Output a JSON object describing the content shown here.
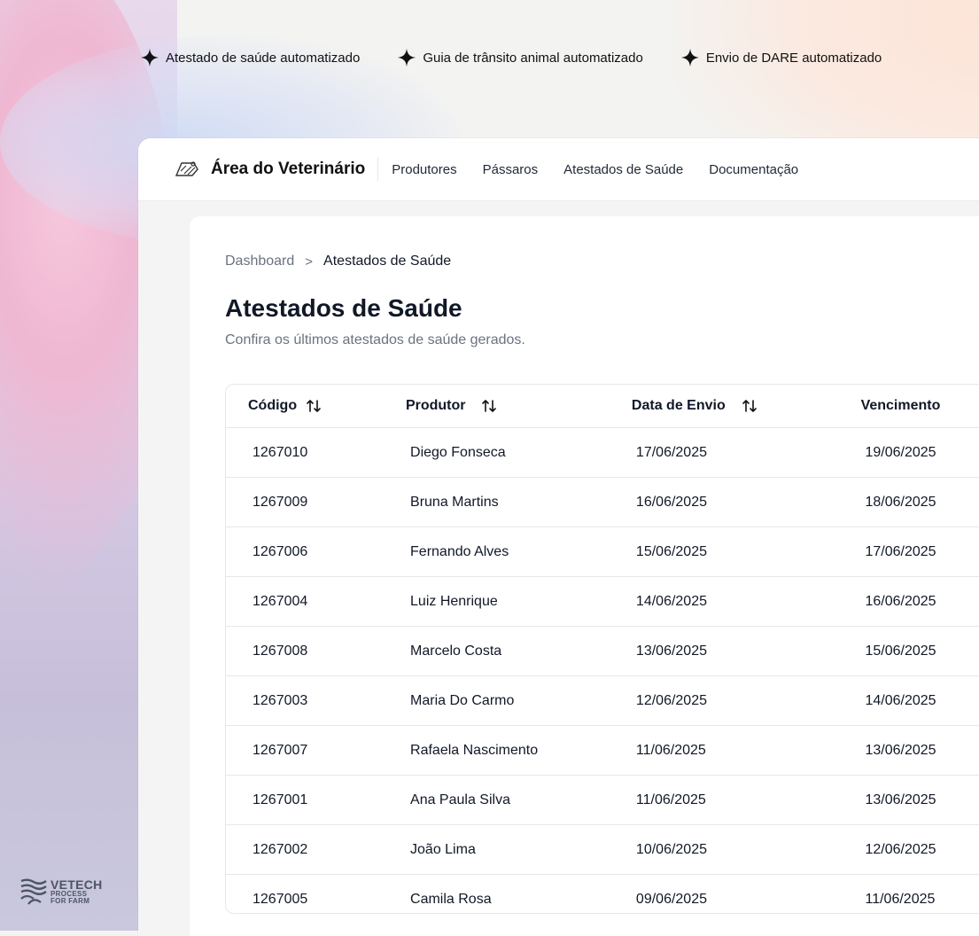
{
  "features": [
    {
      "label": "Atestado de saúde automatizado",
      "icon": "sparkle-icon"
    },
    {
      "label": "Guia de trânsito animal automatizado",
      "icon": "sparkle-icon"
    },
    {
      "label": "Envio de DARE automatizado",
      "icon": "sparkle-icon"
    }
  ],
  "header": {
    "brand_title": "Área do Veterinário",
    "brand_icon": "veterinary-logo-icon",
    "nav": [
      "Produtores",
      "Pássaros",
      "Atestados de Saúde",
      "Documentação"
    ]
  },
  "breadcrumb": {
    "home": "Dashboard",
    "separator": ">",
    "current": "Atestados de Saúde"
  },
  "page": {
    "title": "Atestados de Saúde",
    "subtitle": "Confira os últimos atestados de saúde gerados."
  },
  "table": {
    "columns": [
      "Código",
      "Produtor",
      "Data de Envio",
      "Vencimento"
    ],
    "rows": [
      {
        "codigo": "1267010",
        "produtor": "Diego Fonseca",
        "envio": "17/06/2025",
        "vencimento": "19/06/2025"
      },
      {
        "codigo": "1267009",
        "produtor": "Bruna Martins",
        "envio": "16/06/2025",
        "vencimento": "18/06/2025"
      },
      {
        "codigo": "1267006",
        "produtor": "Fernando Alves",
        "envio": "15/06/2025",
        "vencimento": "17/06/2025"
      },
      {
        "codigo": "1267004",
        "produtor": "Luiz Henrique",
        "envio": "14/06/2025",
        "vencimento": "16/06/2025"
      },
      {
        "codigo": "1267008",
        "produtor": "Marcelo Costa",
        "envio": "13/06/2025",
        "vencimento": "15/06/2025"
      },
      {
        "codigo": "1267003",
        "produtor": "Maria Do Carmo",
        "envio": "12/06/2025",
        "vencimento": "14/06/2025"
      },
      {
        "codigo": "1267007",
        "produtor": "Rafaela Nascimento",
        "envio": "11/06/2025",
        "vencimento": "13/06/2025"
      },
      {
        "codigo": "1267001",
        "produtor": "Ana Paula Silva",
        "envio": "11/06/2025",
        "vencimento": "13/06/2025"
      },
      {
        "codigo": "1267002",
        "produtor": "João Lima",
        "envio": "10/06/2025",
        "vencimento": "12/06/2025"
      },
      {
        "codigo": "1267005",
        "produtor": "Camila Rosa",
        "envio": "09/06/2025",
        "vencimento": "11/06/2025"
      }
    ]
  },
  "footer_logo": {
    "name": "VETECH",
    "line1": "PROCESS",
    "line2": "FOR FARM"
  }
}
